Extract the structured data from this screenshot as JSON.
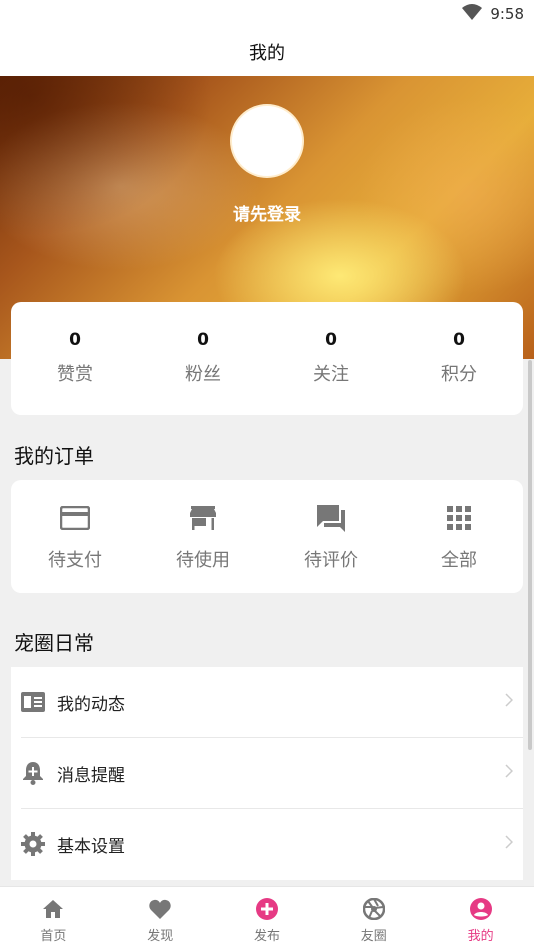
{
  "status_bar": {
    "time": "9:58",
    "icons": [
      "wifi-icon"
    ]
  },
  "header": {
    "title": "我的"
  },
  "profile": {
    "login_prompt": "请先登录"
  },
  "stats": [
    {
      "value": "0",
      "label": "赞赏"
    },
    {
      "value": "0",
      "label": "粉丝"
    },
    {
      "value": "0",
      "label": "关注"
    },
    {
      "value": "0",
      "label": "积分"
    }
  ],
  "orders": {
    "title": "我的订单",
    "items": [
      {
        "label": "待支付",
        "icon": "credit-card-icon"
      },
      {
        "label": "待使用",
        "icon": "store-icon"
      },
      {
        "label": "待评价",
        "icon": "review-chat-icon"
      },
      {
        "label": "全部",
        "icon": "grid-icon"
      }
    ]
  },
  "daily": {
    "title": "宠圈日常",
    "items": [
      {
        "label": "我的动态",
        "icon": "feed-icon"
      },
      {
        "label": "消息提醒",
        "icon": "notification-bell-icon"
      },
      {
        "label": "基本设置",
        "icon": "settings-gear-icon"
      }
    ]
  },
  "bottom_nav": {
    "active_index": 4,
    "accent_color": "#e63a84",
    "items": [
      {
        "label": "首页",
        "icon": "home-icon"
      },
      {
        "label": "发现",
        "icon": "heart-icon"
      },
      {
        "label": "发布",
        "icon": "add-circle-icon"
      },
      {
        "label": "友圈",
        "icon": "aperture-icon"
      },
      {
        "label": "我的",
        "icon": "account-circle-icon"
      }
    ]
  }
}
